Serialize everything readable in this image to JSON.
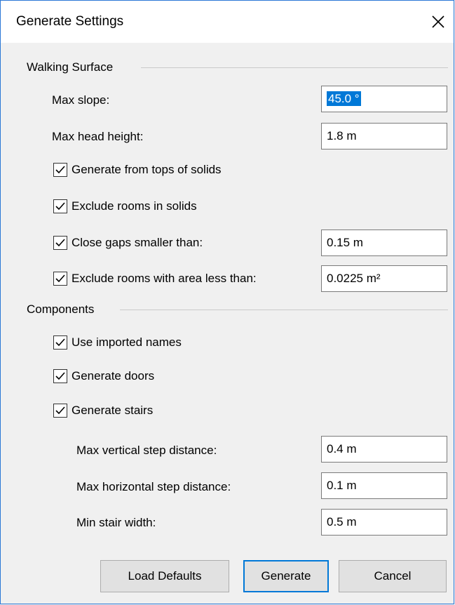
{
  "window": {
    "title": "Generate Settings"
  },
  "walking_surface": {
    "label": "Walking Surface",
    "max_slope_label": "Max slope:",
    "max_slope_value": "45.0 °",
    "max_head_height_label": "Max head height:",
    "max_head_height_value": "1.8 m",
    "tops_of_solids_label": "Generate from tops of solids",
    "exclude_rooms_solids_label": "Exclude rooms in solids",
    "close_gaps_label": "Close gaps smaller than:",
    "close_gaps_value": "0.15 m",
    "exclude_area_label": "Exclude rooms with area less than:",
    "exclude_area_value": "0.0225 m²"
  },
  "components": {
    "label": "Components",
    "imported_names_label": "Use imported names",
    "doors_label": "Generate doors",
    "stairs_label": "Generate stairs",
    "max_vertical_label": "Max vertical step distance:",
    "max_vertical_value": "0.4 m",
    "max_horizontal_label": "Max horizontal step distance:",
    "max_horizontal_value": "0.1 m",
    "min_stair_width_label": "Min stair width:",
    "min_stair_width_value": "0.5 m"
  },
  "buttons": {
    "load_defaults": "Load Defaults",
    "generate": "Generate",
    "cancel": "Cancel"
  }
}
